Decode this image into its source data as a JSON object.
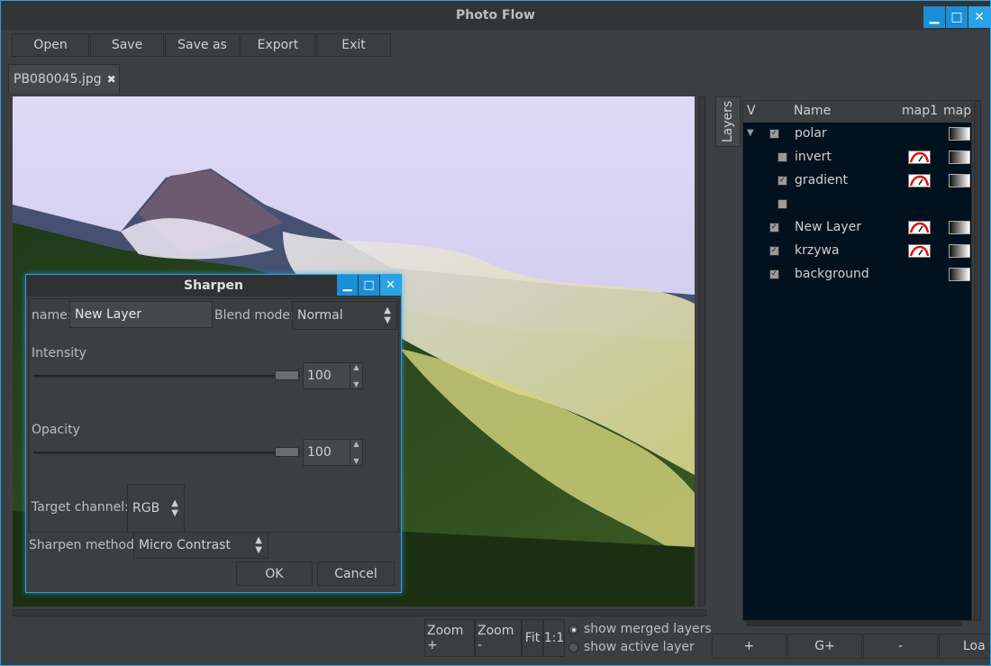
{
  "window": {
    "title": "Photo Flow",
    "controls": [
      "▁",
      "□",
      "✕"
    ]
  },
  "toolbar": [
    "Open",
    "Save",
    "Save as",
    "Export",
    "Exit"
  ],
  "tab": {
    "label": "PB080045.jpg",
    "close": "✖"
  },
  "bottom": {
    "zoom_in": "Zoom +",
    "zoom_out": "Zoom -",
    "fit": "Fit",
    "one_to_one": "1:1",
    "show_merged": "show merged layers",
    "show_active": "show active layer"
  },
  "layers": {
    "side_tab": "Layers",
    "headers": {
      "v": "V",
      "name": "Name",
      "map1": "map1",
      "map2": "map"
    },
    "rows": [
      {
        "name": "polar",
        "checked": true,
        "indent": 0,
        "expander": "▼",
        "curve": false,
        "grad": true
      },
      {
        "name": "invert",
        "checked": false,
        "indent": 1,
        "curve": true,
        "grad": true
      },
      {
        "name": "gradient",
        "checked": true,
        "indent": 1,
        "curve": true,
        "grad": true
      },
      {
        "name": "",
        "checked": false,
        "indent": 1,
        "curve": false,
        "grad": false
      },
      {
        "name": "New Layer",
        "checked": true,
        "indent": 0,
        "curve": true,
        "grad": true
      },
      {
        "name": "krzywa",
        "checked": true,
        "indent": 0,
        "curve": true,
        "grad": true
      },
      {
        "name": "background",
        "checked": true,
        "indent": 0,
        "curve": false,
        "grad": true
      }
    ],
    "buttons": [
      "+",
      "G+",
      "-",
      "Loa"
    ]
  },
  "dialog": {
    "title": "Sharpen",
    "controls": [
      "▁",
      "□",
      "✕"
    ],
    "name_label": "name:",
    "name_value": "New Layer",
    "blend_label": "Blend mode:",
    "blend_value": "Normal",
    "intensity_label": "Intensity",
    "intensity_value": "100",
    "opacity_label": "Opacity",
    "opacity_value": "100",
    "target_label": "Target channel:",
    "target_value": "RGB",
    "method_label": "Sharpen method:",
    "method_value": "Micro Contrast",
    "ok": "OK",
    "cancel": "Cancel"
  },
  "colors": {
    "accent": "#2aa2e6",
    "panel": "#3c3f41",
    "layers_bg": "#02111e"
  }
}
